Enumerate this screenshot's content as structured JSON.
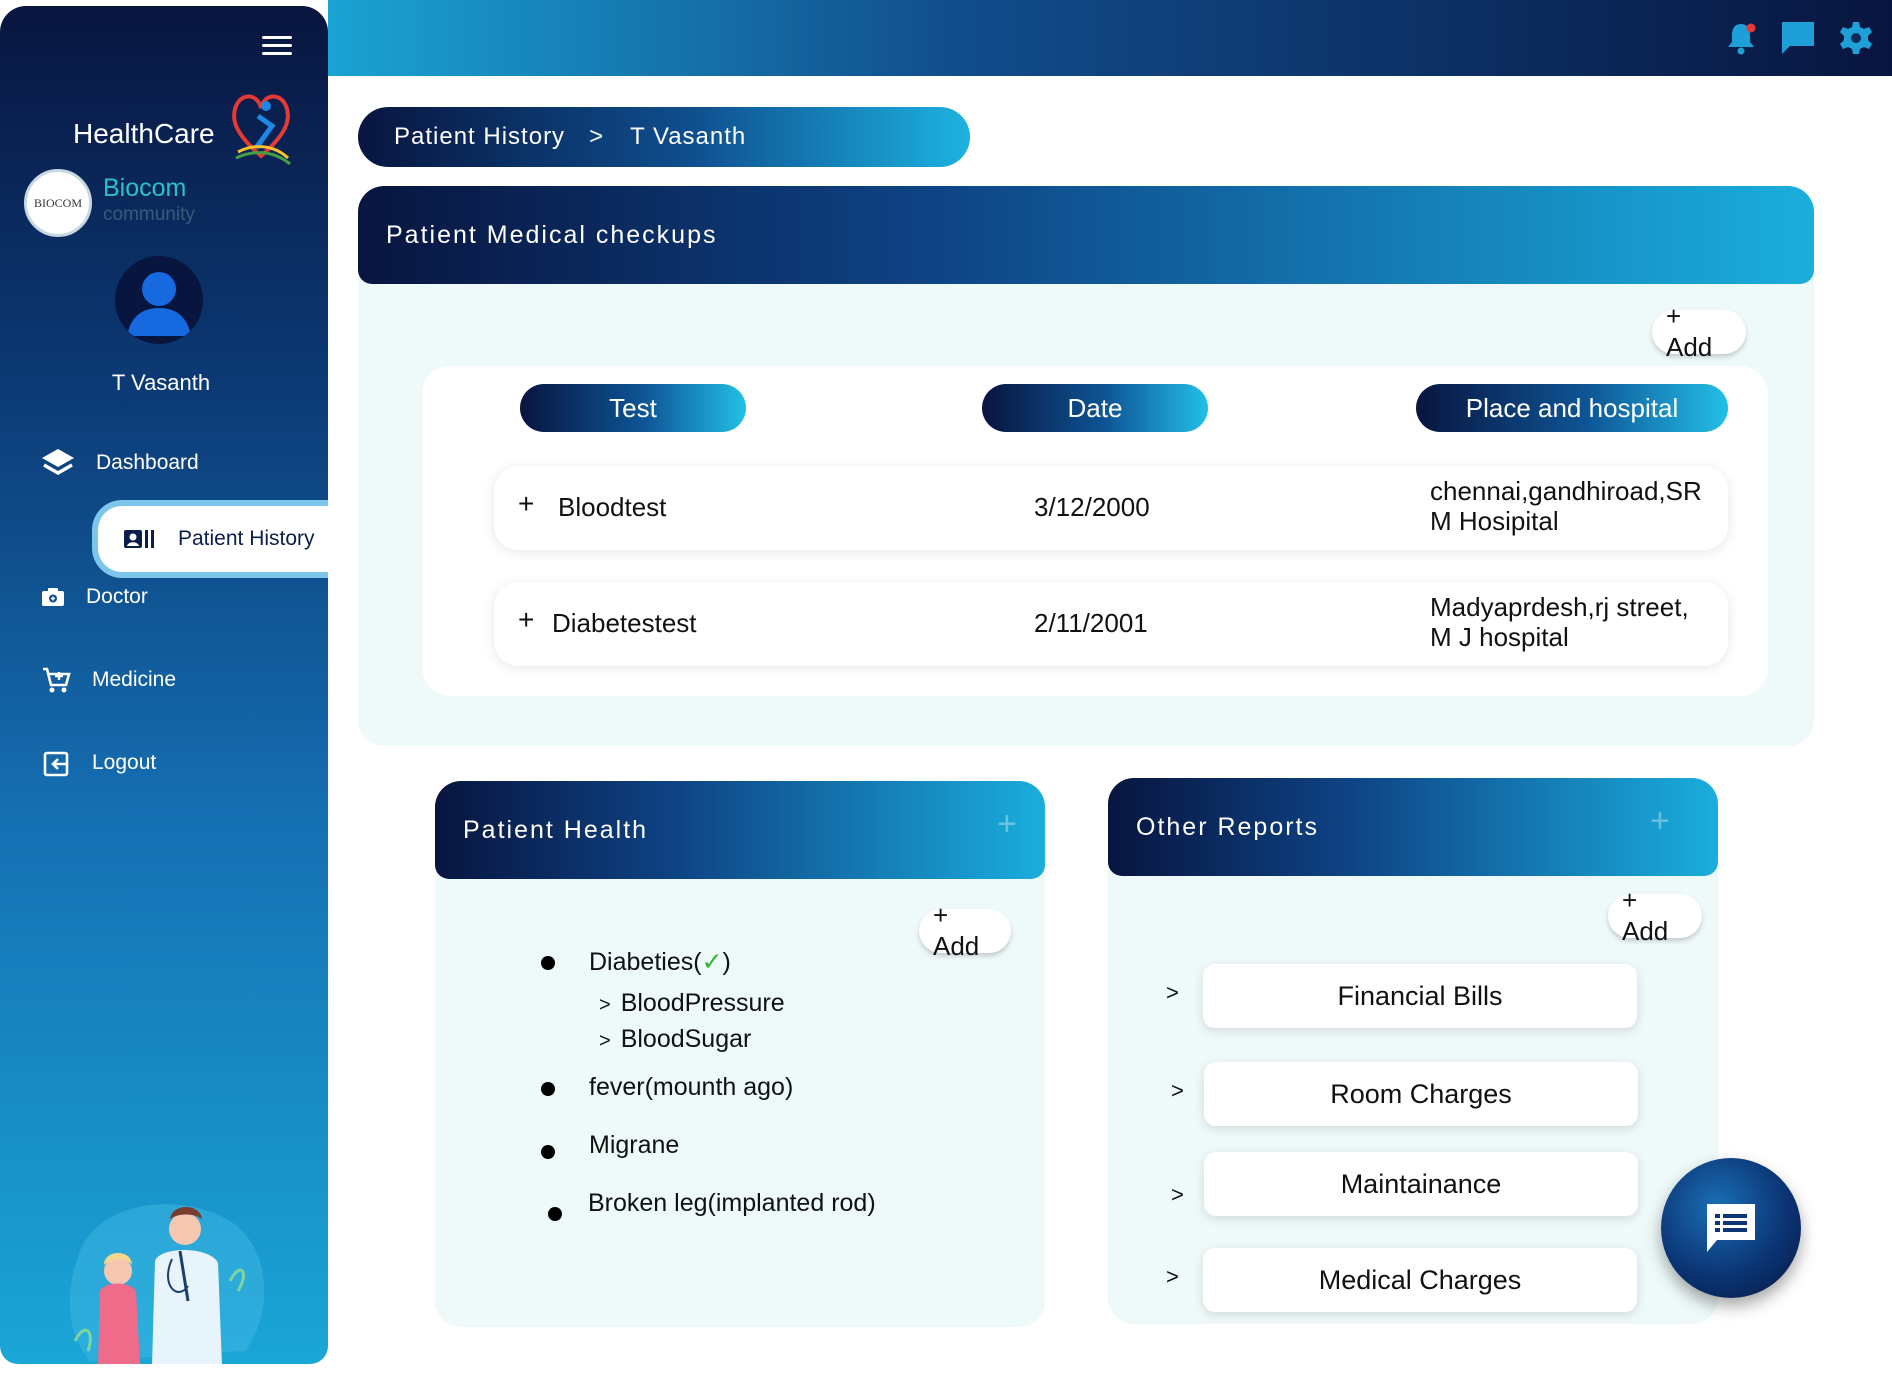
{
  "app": {
    "brand": "HealthCare",
    "community_name": "Biocom",
    "community_sub": "community",
    "community_logo_text": "BIOCOM"
  },
  "user": {
    "name": "T Vasanth"
  },
  "sidebar": {
    "items": [
      {
        "label": "Dashboard",
        "icon": "layers-icon"
      },
      {
        "label": "Patient History",
        "icon": "id-card-icon",
        "active": true
      },
      {
        "label": "Doctor",
        "icon": "camera-icon"
      },
      {
        "label": "Medicine",
        "icon": "cart-icon"
      },
      {
        "label": "Logout",
        "icon": "logout-icon"
      }
    ]
  },
  "topbar": {
    "icons": [
      "bell-icon",
      "chat-icon",
      "gear-icon"
    ]
  },
  "breadcrumb": {
    "section": "Patient History",
    "separator": ">",
    "current": "T Vasanth"
  },
  "checkups": {
    "title": "Patient Medical checkups",
    "add_label": "+ Add",
    "columns": [
      "Test",
      "Date",
      "Place and hospital"
    ],
    "rows": [
      {
        "expand": "+",
        "test": "Bloodtest",
        "date": "3/12/2000",
        "place_line1": "chennai,gandhiroad,SR",
        "place_line2": "M Hosipital"
      },
      {
        "expand": "+",
        "test": "Diabetestest",
        "date": "2/11/2001",
        "place_line1": "Madyaprdesh,rj street,",
        "place_line2": "M J hospital"
      }
    ]
  },
  "health": {
    "title": "Patient Health",
    "add_label": "+ Add",
    "items": [
      {
        "label": "Diabeties(",
        "check": "✓",
        "label_end": ")"
      },
      {
        "label": "fever(mounth ago)"
      },
      {
        "label": "Migrane"
      },
      {
        "label": "Broken leg(implanted rod)"
      }
    ],
    "sub_items": [
      "BloodPressure",
      "BloodSugar"
    ]
  },
  "reports": {
    "title": "Other Reports",
    "add_label": "+ Add",
    "items": [
      "Financial Bills",
      "Room Charges",
      "Maintainance",
      "Medical Charges"
    ]
  },
  "colors": {
    "navy": "#08153f",
    "cyan": "#1aaedd",
    "panel_bg": "#eef9f9",
    "check_green": "#2eb82e"
  }
}
